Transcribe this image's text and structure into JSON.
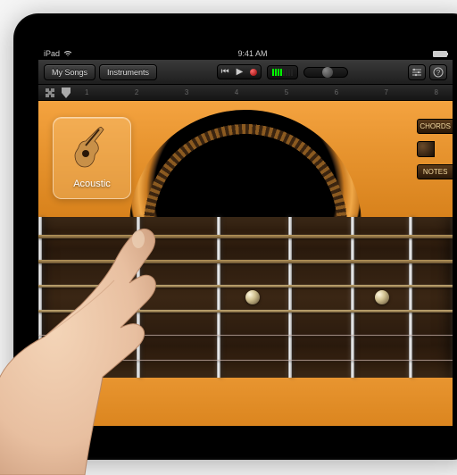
{
  "status": {
    "device": "iPad",
    "time": "9:41 AM"
  },
  "toolbar": {
    "my_songs": "My Songs",
    "instruments": "Instruments"
  },
  "ruler": [
    "1",
    "2",
    "3",
    "4",
    "5",
    "6",
    "7",
    "8"
  ],
  "instrument": {
    "label": "Acoustic"
  },
  "side": {
    "chords": "CHORDS",
    "notes": "NOTES"
  },
  "guitar": {
    "strings": 6,
    "fret_positions": [
      0,
      110,
      200,
      280,
      350,
      415,
      465
    ],
    "markers": [
      240,
      385
    ],
    "string_offsets": [
      20,
      48,
      76,
      104,
      132,
      160
    ]
  }
}
